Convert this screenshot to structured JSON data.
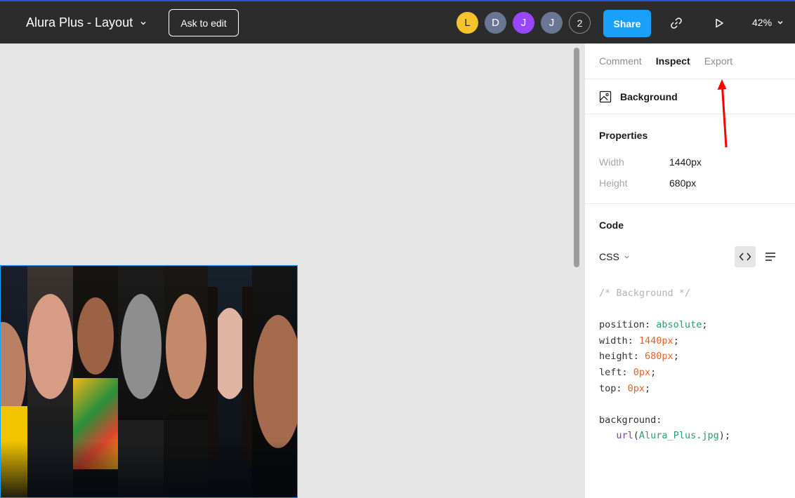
{
  "topbar": {
    "file_title": "Alura Plus - Layout",
    "ask_to_edit": "Ask to edit",
    "avatars": [
      {
        "letter": "L",
        "color": "#f5c32c",
        "text_color": "#1a1a1a"
      },
      {
        "letter": "D",
        "color": "#6a7693",
        "text_color": "#ffffff"
      },
      {
        "letter": "J",
        "color": "#9747ff",
        "text_color": "#ffffff"
      },
      {
        "letter": "J",
        "color": "#6a7693",
        "text_color": "#ffffff"
      }
    ],
    "more_count": "2",
    "share_label": "Share",
    "zoom": "42%",
    "accent": "#18a0fb"
  },
  "panel": {
    "tabs": [
      {
        "label": "Comment",
        "active": false
      },
      {
        "label": "Inspect",
        "active": true
      },
      {
        "label": "Export",
        "active": false
      }
    ],
    "layer_name": "Background",
    "properties": {
      "title": "Properties",
      "width_label": "Width",
      "width_value": "1440px",
      "height_label": "Height",
      "height_value": "680px"
    },
    "code": {
      "title": "Code",
      "language": "CSS",
      "comment": "/* Background */",
      "lines": [
        {
          "prop": "position",
          "value": "absolute",
          "kind": "str"
        },
        {
          "prop": "width",
          "value": "1440px",
          "kind": "num"
        },
        {
          "prop": "height",
          "value": "680px",
          "kind": "num"
        },
        {
          "prop": "left",
          "value": "0px",
          "kind": "num"
        },
        {
          "prop": "top",
          "value": "0px",
          "kind": "num"
        }
      ],
      "background_prop": "background",
      "url_fn": "url",
      "url_value": "Alura_Plus.jpg"
    }
  },
  "canvas": {
    "annotation_color": "#ff0000"
  }
}
